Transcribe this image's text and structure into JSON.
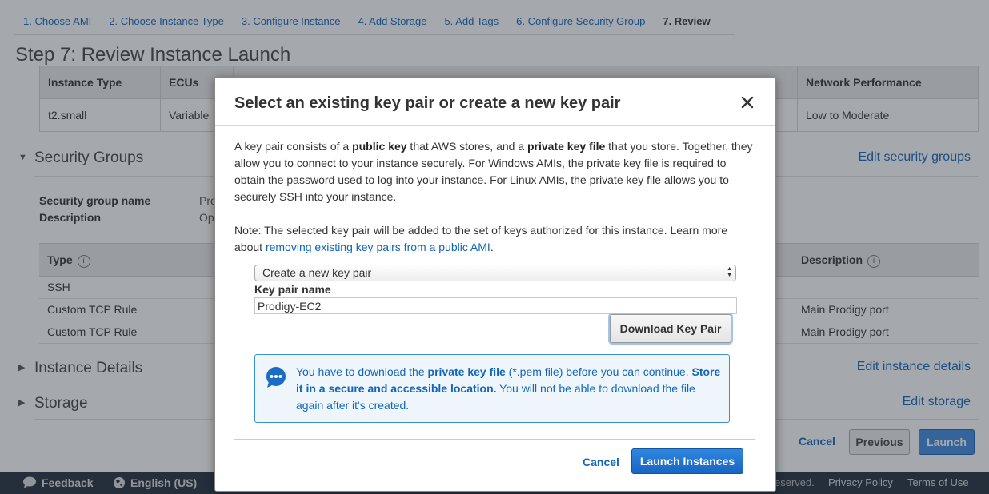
{
  "wizard": {
    "steps": [
      {
        "label": "1. Choose AMI"
      },
      {
        "label": "2. Choose Instance Type"
      },
      {
        "label": "3. Configure Instance"
      },
      {
        "label": "4. Add Storage"
      },
      {
        "label": "5. Add Tags"
      },
      {
        "label": "6. Configure Security Group"
      },
      {
        "label": "7. Review"
      }
    ],
    "active_step": "7. Review",
    "accent_color": "#e77c2f"
  },
  "page": {
    "title": "Step 7: Review Instance Launch"
  },
  "instance_table": {
    "headers": {
      "instance_type": "Instance Type",
      "ecus": "ECUs",
      "network": "Network Performance"
    },
    "row": {
      "instance_type": "t2.small",
      "ecus": "Variable",
      "network": "Low to Moderate"
    }
  },
  "security_groups": {
    "heading": "Security Groups",
    "edit_link": "Edit security groups",
    "name_label": "Security group name",
    "name_value": "Pro",
    "description_label": "Description",
    "description_value": "Op",
    "table_headers": {
      "type": "Type",
      "description": "Description"
    },
    "rows": [
      {
        "type": "SSH",
        "description": ""
      },
      {
        "type": "Custom TCP Rule",
        "description": "Main Prodigy port"
      },
      {
        "type": "Custom TCP Rule",
        "description": "Main Prodigy port"
      }
    ]
  },
  "instance_details": {
    "heading": "Instance Details",
    "edit_link": "Edit instance details"
  },
  "storage": {
    "heading": "Storage",
    "edit_link": "Edit storage"
  },
  "bottom_actions": {
    "cancel": "Cancel",
    "previous": "Previous",
    "launch": "Launch"
  },
  "footer": {
    "feedback": "Feedback",
    "language": "English (US)",
    "reserved": "eserved.",
    "privacy": "Privacy Policy",
    "terms": "Terms of Use"
  },
  "modal": {
    "title": "Select an existing key pair or create a new key pair",
    "intro": {
      "t1": "A key pair consists of a ",
      "b1": "public key",
      "t2": " that AWS stores, and a ",
      "b2": "private key file",
      "t3": " that you store. Together, they allow you to connect to your instance securely. For Windows AMIs, the private key file is required to obtain the password used to log into your instance. For Linux AMIs, the private key file allows you to securely SSH into your instance."
    },
    "note": {
      "t1": "Note: The selected key pair will be added to the set of keys authorized for this instance. Learn more about ",
      "link": "removing existing key pairs from a public AMI",
      "t2": "."
    },
    "key_pair_select": {
      "selected": "Create a new key pair"
    },
    "key_pair_name_label": "Key pair name",
    "key_pair_name_value": "Prodigy-EC2",
    "download_button": "Download Key Pair",
    "alert": {
      "t1": "You have to download the ",
      "b1": "private key file",
      "t2": " (*.pem file) before you can continue. ",
      "b2": "Store it in a secure and accessible location.",
      "t3": " You will not be able to download the file again after it's created."
    },
    "cancel": "Cancel",
    "launch": "Launch Instances"
  }
}
